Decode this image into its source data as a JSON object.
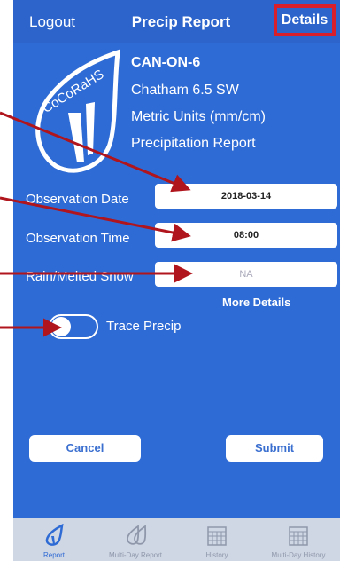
{
  "nav": {
    "logout": "Logout",
    "title": "Precip Report",
    "details": "Details"
  },
  "logo_text": "CoCoRaHS",
  "station": {
    "id": "CAN-ON-6",
    "name": "Chatham 6.5 SW",
    "units": "Metric Units (mm/cm)",
    "report_type": "Precipitation Report"
  },
  "form": {
    "obs_date_label": "Observation Date",
    "obs_date_value": "2018-03-14",
    "obs_time_label": "Observation Time",
    "obs_time_value": "08:00",
    "rain_label": "Rain/Melted Snow",
    "rain_placeholder": "NA",
    "more_details": "More Details",
    "trace_label": "Trace Precip",
    "trace_on": false
  },
  "buttons": {
    "cancel": "Cancel",
    "submit": "Submit"
  },
  "tabs": [
    {
      "label": "Report",
      "icon": "drop-icon",
      "active": true
    },
    {
      "label": "Multi-Day Report",
      "icon": "multi-drop-icon",
      "active": false
    },
    {
      "label": "History",
      "icon": "calendar-icon",
      "active": false
    },
    {
      "label": "Multi-Day History",
      "icon": "calendar-icon",
      "active": false
    }
  ],
  "colors": {
    "background": "#2f6bd4",
    "highlight": "#d9202a",
    "arrow": "#b0141c"
  }
}
